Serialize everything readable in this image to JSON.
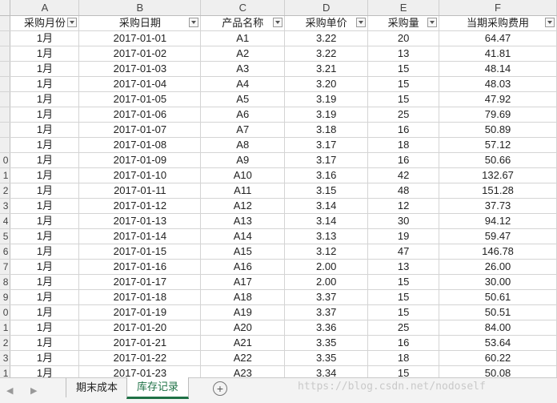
{
  "columns": [
    "A",
    "B",
    "C",
    "D",
    "E",
    "F"
  ],
  "headers": [
    "采购月份",
    "采购日期",
    "产品名称",
    "采购单价",
    "采购量",
    "当期采购费用"
  ],
  "row_numbers": [
    "",
    "",
    "",
    "",
    "",
    "",
    "",
    "",
    "0",
    "1",
    "2",
    "3",
    "4",
    "5",
    "6",
    "7",
    "8",
    "9",
    "0",
    "1",
    "2",
    "3",
    "1"
  ],
  "rows": [
    [
      "1月",
      "2017-01-01",
      "A1",
      "3.22",
      "20",
      "64.47"
    ],
    [
      "1月",
      "2017-01-02",
      "A2",
      "3.22",
      "13",
      "41.81"
    ],
    [
      "1月",
      "2017-01-03",
      "A3",
      "3.21",
      "15",
      "48.14"
    ],
    [
      "1月",
      "2017-01-04",
      "A4",
      "3.20",
      "15",
      "48.03"
    ],
    [
      "1月",
      "2017-01-05",
      "A5",
      "3.19",
      "15",
      "47.92"
    ],
    [
      "1月",
      "2017-01-06",
      "A6",
      "3.19",
      "25",
      "79.69"
    ],
    [
      "1月",
      "2017-01-07",
      "A7",
      "3.18",
      "16",
      "50.89"
    ],
    [
      "1月",
      "2017-01-08",
      "A8",
      "3.17",
      "18",
      "57.12"
    ],
    [
      "1月",
      "2017-01-09",
      "A9",
      "3.17",
      "16",
      "50.66"
    ],
    [
      "1月",
      "2017-01-10",
      "A10",
      "3.16",
      "42",
      "132.67"
    ],
    [
      "1月",
      "2017-01-11",
      "A11",
      "3.15",
      "48",
      "151.28"
    ],
    [
      "1月",
      "2017-01-12",
      "A12",
      "3.14",
      "12",
      "37.73"
    ],
    [
      "1月",
      "2017-01-13",
      "A13",
      "3.14",
      "30",
      "94.12"
    ],
    [
      "1月",
      "2017-01-14",
      "A14",
      "3.13",
      "19",
      "59.47"
    ],
    [
      "1月",
      "2017-01-15",
      "A15",
      "3.12",
      "47",
      "146.78"
    ],
    [
      "1月",
      "2017-01-16",
      "A16",
      "2.00",
      "13",
      "26.00"
    ],
    [
      "1月",
      "2017-01-17",
      "A17",
      "2.00",
      "15",
      "30.00"
    ],
    [
      "1月",
      "2017-01-18",
      "A18",
      "3.37",
      "15",
      "50.61"
    ],
    [
      "1月",
      "2017-01-19",
      "A19",
      "3.37",
      "15",
      "50.51"
    ],
    [
      "1月",
      "2017-01-20",
      "A20",
      "3.36",
      "25",
      "84.00"
    ],
    [
      "1月",
      "2017-01-21",
      "A21",
      "3.35",
      "16",
      "53.64"
    ],
    [
      "1月",
      "2017-01-22",
      "A22",
      "3.35",
      "18",
      "60.22"
    ],
    [
      "1月",
      "2017-01-23",
      "A23",
      "3.34",
      "15",
      "50.08"
    ]
  ],
  "sheet_tabs": [
    {
      "label": "期末成本",
      "active": false
    },
    {
      "label": "库存记录",
      "active": true
    }
  ],
  "nav": {
    "prev": "◀",
    "next": "▶",
    "add": "+"
  },
  "watermark": "https://blog.csdn.net/nodoself",
  "colors": {
    "active_tab": "#1e7145",
    "header_bg": "#efefef",
    "grid": "#d4d4d4"
  }
}
